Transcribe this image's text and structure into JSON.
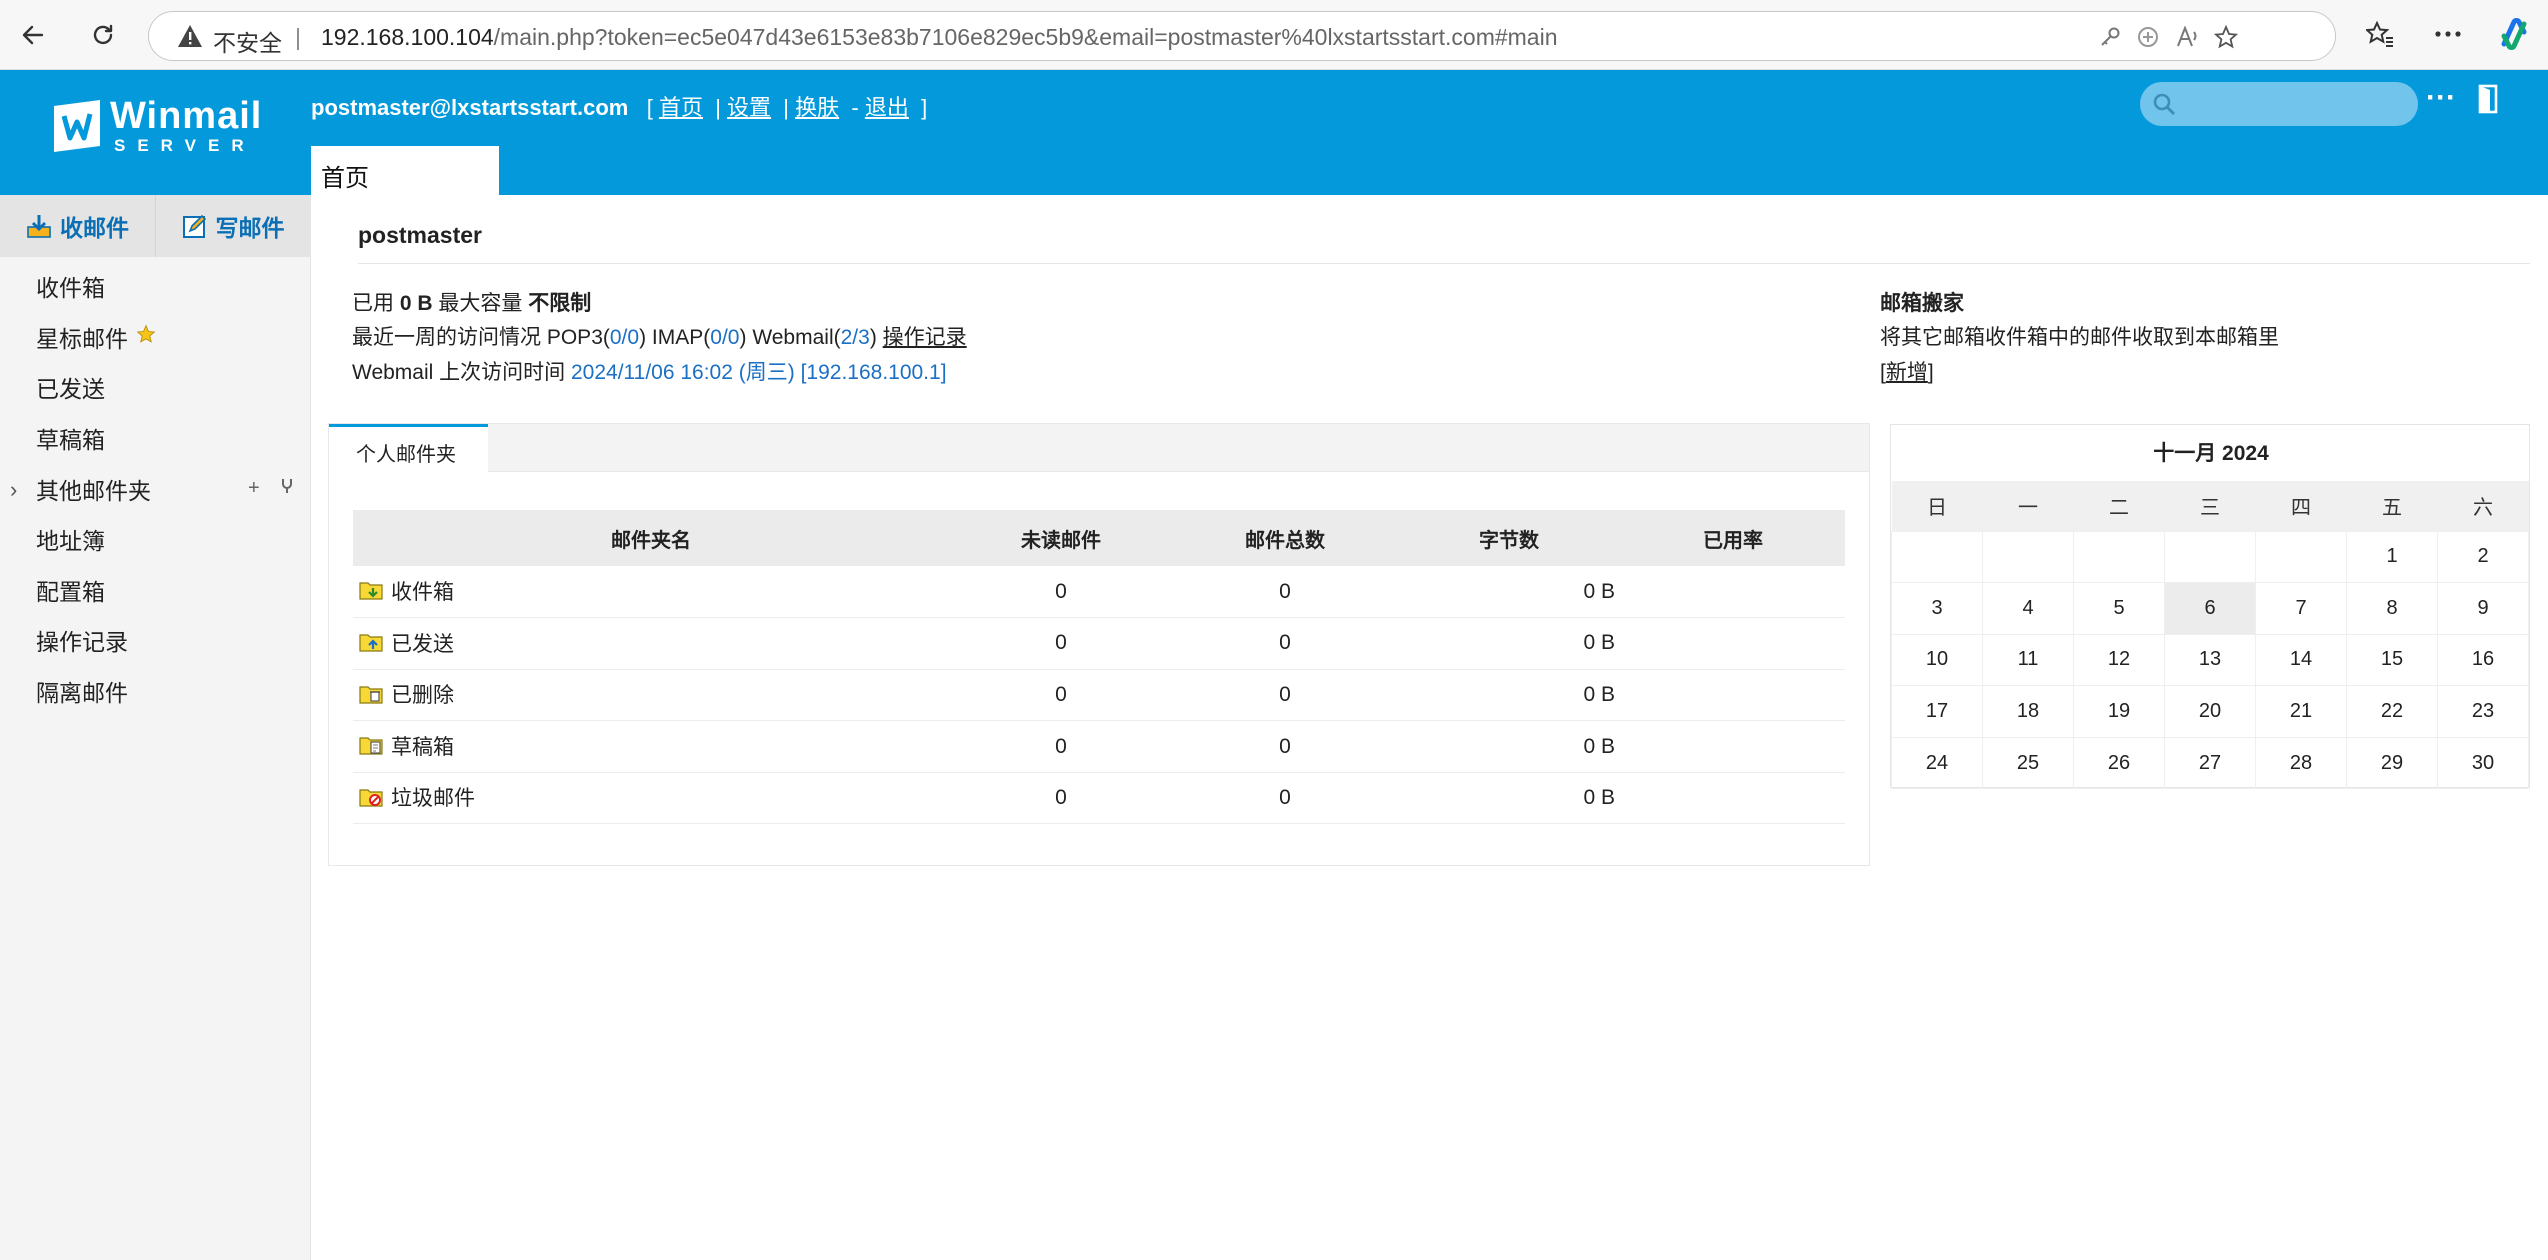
{
  "browser": {
    "security_label": "不安全",
    "url_host": "192.168.100.104",
    "url_path": "/main.php?token=ec5e047d43e6153e83b7106e829ec5b9&email=postmaster%40lxstartsstart.com#main"
  },
  "header": {
    "logo_main": "Winmail",
    "logo_sub": "SERVER",
    "user_email": "postmaster@lxstartsstart.com",
    "links": [
      "首页",
      "设置",
      "换肤",
      "退出"
    ],
    "search_placeholder": "",
    "home_tab": "首页"
  },
  "sidebar": {
    "receive_label": "收邮件",
    "compose_label": "写邮件",
    "items": [
      {
        "label": "收件箱"
      },
      {
        "label": "星标邮件"
      },
      {
        "label": "已发送"
      },
      {
        "label": "草稿箱"
      },
      {
        "label": "其他邮件夹"
      },
      {
        "label": "地址簿"
      },
      {
        "label": "配置箱"
      },
      {
        "label": "操作记录"
      },
      {
        "label": "隔离邮件"
      }
    ],
    "add_symbol": "+"
  },
  "main": {
    "account_name": "postmaster",
    "usage": {
      "used_label": "已用",
      "used_value": "0 B",
      "max_label": "最大容量",
      "max_value": "不限制"
    },
    "access": {
      "prefix": "最近一周的访问情况",
      "pop3_label": "POP3(",
      "pop3_value": "0/0",
      "imap_label": "IMAP(",
      "imap_value": "0/0",
      "webmail_label": "Webmail(",
      "webmail_value": "2/3",
      "close_paren": ")",
      "log_link": "操作记录"
    },
    "last_visit": {
      "label": "Webmail 上次访问时间",
      "value": "2024/11/06 16:02 (周三) [192.168.100.1]"
    },
    "migration": {
      "title": "邮箱搬家",
      "desc": "将其它邮箱收件箱中的邮件收取到本邮箱里",
      "add_link": "新增"
    }
  },
  "folders": {
    "tab_label": "个人邮件夹",
    "columns": [
      "邮件夹名",
      "未读邮件",
      "邮件总数",
      "字节数",
      "已用率"
    ],
    "rows": [
      {
        "name": "收件箱",
        "unread": "0",
        "total": "0",
        "bytes": "0 B",
        "usage": ""
      },
      {
        "name": "已发送",
        "unread": "0",
        "total": "0",
        "bytes": "0 B",
        "usage": ""
      },
      {
        "name": "已删除",
        "unread": "0",
        "total": "0",
        "bytes": "0 B",
        "usage": ""
      },
      {
        "name": "草稿箱",
        "unread": "0",
        "total": "0",
        "bytes": "0 B",
        "usage": ""
      },
      {
        "name": "垃圾邮件",
        "unread": "0",
        "total": "0",
        "bytes": "0 B",
        "usage": ""
      }
    ]
  },
  "calendar": {
    "title": "十一月  2024",
    "weekdays": [
      "日",
      "一",
      "二",
      "三",
      "四",
      "五",
      "六"
    ],
    "weeks": [
      [
        "",
        "",
        "",
        "",
        "",
        "1",
        "2"
      ],
      [
        "3",
        "4",
        "5",
        "6",
        "7",
        "8",
        "9"
      ],
      [
        "10",
        "11",
        "12",
        "13",
        "14",
        "15",
        "16"
      ],
      [
        "17",
        "18",
        "19",
        "20",
        "21",
        "22",
        "23"
      ],
      [
        "24",
        "25",
        "26",
        "27",
        "28",
        "29",
        "30"
      ]
    ],
    "today": "6"
  },
  "colors": {
    "brand": "#0499db",
    "link_blue": "#1b6fc4",
    "sidebar_bg": "#f4f4f4"
  }
}
